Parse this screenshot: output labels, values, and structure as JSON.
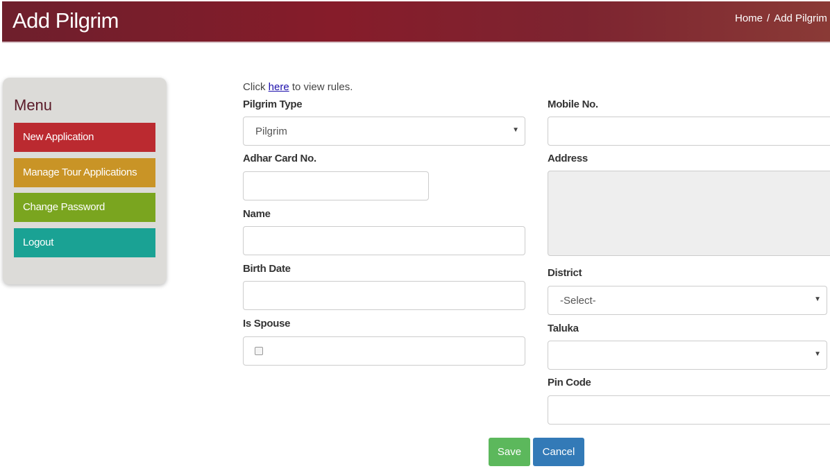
{
  "header": {
    "title": "Add Pilgrim",
    "breadcrumb": [
      "Home",
      "/",
      "Add Pilgrim"
    ]
  },
  "menu": {
    "title": "Menu",
    "items": [
      {
        "label": "New Application",
        "color": "#bb2a30"
      },
      {
        "label": "Manage Tour Applications",
        "color": "#c99426"
      },
      {
        "label": "Change Password",
        "color": "#7aa51f"
      },
      {
        "label": "Logout",
        "color": "#1aa294"
      }
    ]
  },
  "form": {
    "note_prefix": "Click ",
    "note_link": "here",
    "note_suffix": " to view rules.",
    "pilgrim_type": {
      "label": "Pilgrim Type",
      "value": "Pilgrim"
    },
    "adhar": {
      "label": "Adhar Card No.",
      "value": ""
    },
    "name": {
      "label": "Name",
      "value": ""
    },
    "birth_date": {
      "label": "Birth Date",
      "value": ""
    },
    "is_spouse": {
      "label": "Is Spouse",
      "checked": false
    },
    "mobile": {
      "label": "Mobile No.",
      "value": ""
    },
    "address": {
      "label": "Address",
      "value": ""
    },
    "district": {
      "label": "District",
      "value": "-Select-"
    },
    "taluka": {
      "label": "Taluka",
      "value": ""
    },
    "pin_code": {
      "label": "Pin Code",
      "value": ""
    },
    "save": "Save",
    "cancel": "Cancel"
  }
}
